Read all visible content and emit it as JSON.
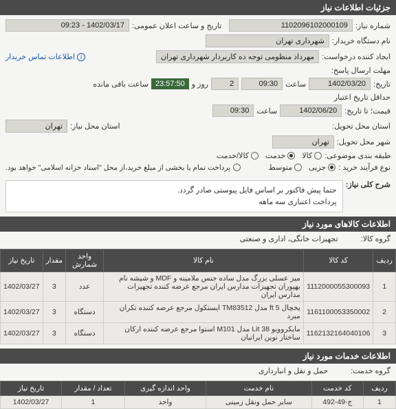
{
  "sections": {
    "need_info": "جزئیات اطلاعات نیاز",
    "need_summary": "شرح کلی نیاز:",
    "goods_info": "اطلاعات کالاهای مورد نیاز",
    "services_info": "اطلاعات خدمات مورد نیاز"
  },
  "fields": {
    "need_no_label": "شماره نیاز:",
    "need_no": "1102096102000109",
    "announce_label": "تاریخ و ساعت اعلان عمومی:",
    "announce": "1402/03/17 - 09:23",
    "buyer_org_label": "نام دستگاه خریدار:",
    "buyer_org": "شهرداری تهران",
    "requester_label": "ایجاد کننده درخواست:",
    "requester": "مهرداد منظومی توجه ده کاربردار شهرداری تهران",
    "contact": "اطلاعات تماس خریدار",
    "deadline_label": "مهلت ارسال پاسخ:",
    "deadline_sub": "تاریخ:",
    "deadline_date": "1402/03/20",
    "time_label": "ساعت",
    "deadline_time": "09:30",
    "day_label": "و",
    "day_label2": "روز و",
    "days": "2",
    "countdown": "23:57:50",
    "remaining": "ساعت باقی مانده",
    "min_valid_label": "حداقل تاریخ اعتبار",
    "price_until": "قیمت؛ تا تاریخ:",
    "min_valid_date": "1402/06/20",
    "min_valid_time": "09:30",
    "need_province_label": "استان محل نیاز:",
    "province": "تهران",
    "delivery_province_label": "استان محل تحویل:",
    "delivery_city_label": "شهر محل تحویل:",
    "city": "تهران",
    "subject_class_label": "طبقه بندی موضوعی:",
    "subject_goods": "کالا",
    "subject_service": "خدمت",
    "subject_both": "کالا/خدمت",
    "purchase_type_label": "نوع فرآیند خرید :",
    "purchase_partial": "جزیی",
    "purchase_medium": "متوسط",
    "payment_note": "پرداخت تمام یا بخشی از مبلغ خرید،از محل \"اسناد خزانه اسلامی\" خواهد بود.",
    "desc1": "حتما پیش فاکتور بر اساس فایل پیوستی صادر  گردد.",
    "desc2": "پرداخت اعتباری سه ماهه",
    "goods_group_label": "گروه کالا:",
    "goods_group": "تجهیزات خانگی، اداری و صنعتی",
    "service_group_label": "گروه خدمت:",
    "service_group": "حمل و نقل و انبارداری"
  },
  "goods_table": {
    "headers": [
      "ردیف",
      "کد کالا",
      "نام کالا",
      "واحد شمارش",
      "مقدار",
      "تاریخ نیاز"
    ],
    "rows": [
      {
        "idx": "1",
        "code": "1112000055300093",
        "name": "میز عسلی بزرگ مدل ساده جنس ملامینه و MDF و شیشه نام بهپوران تجهیزات مدارس ایران مرجع عرضه کننده تجهیزات مدارس ایران",
        "unit": "عدد",
        "qty": "3",
        "date": "1402/03/27"
      },
      {
        "idx": "2",
        "code": "1161100053350002",
        "name": "یخچال 5 ft مدل TM83512 ایستکول مرجع عرضه کننده تکران مبرد",
        "unit": "دستگاه",
        "qty": "3",
        "date": "1402/03/27"
      },
      {
        "idx": "3",
        "code": "1162132164040106",
        "name": "مایکروویو 38 Lit مدل M101 استوا مرجع عرضه کننده ارکان ساختار نوین ایرانیان",
        "unit": "دستگاه",
        "qty": "3",
        "date": "1402/03/27"
      }
    ]
  },
  "services_table": {
    "headers": [
      "ردیف",
      "کد خدمت",
      "نام خدمت",
      "واحد اندازه گیری",
      "تعداد / مقدار",
      "تاریخ نیاز"
    ],
    "rows": [
      {
        "idx": "1",
        "code": "ج-49-492",
        "name": "سایر حمل ونقل زمینی",
        "unit": "واحد",
        "qty": "1",
        "date": "1402/03/27"
      }
    ]
  }
}
